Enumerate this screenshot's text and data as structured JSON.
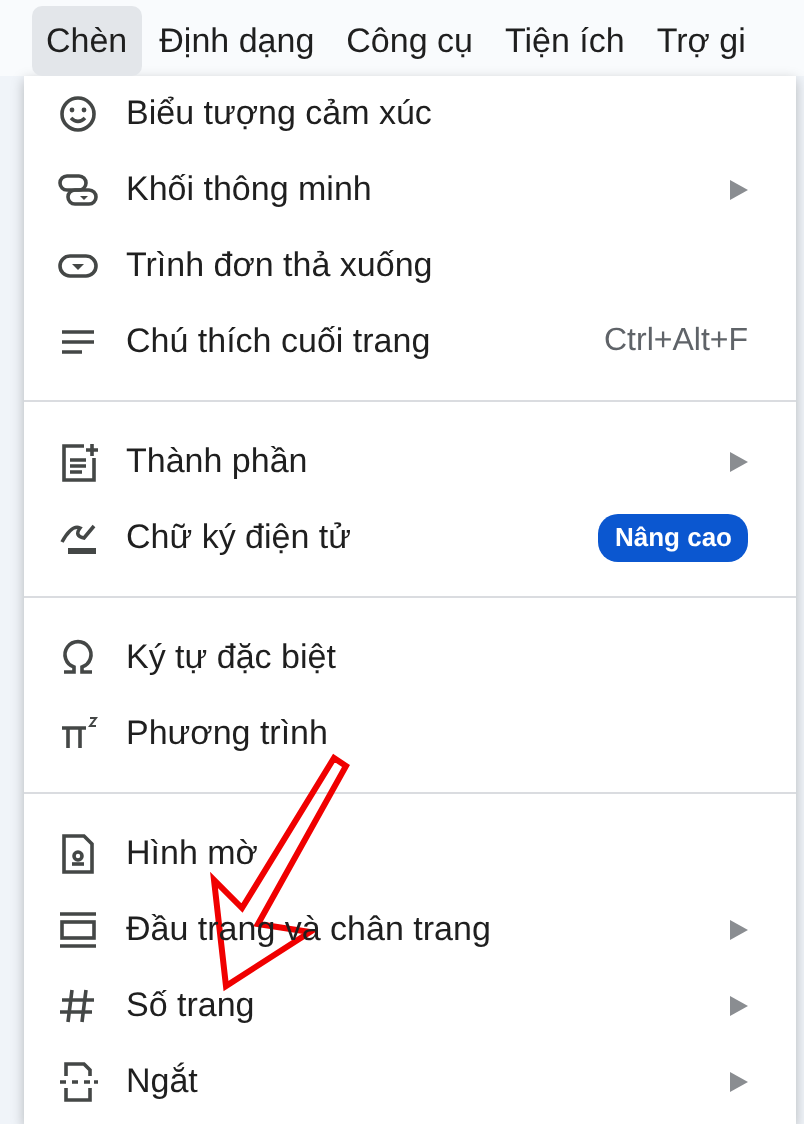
{
  "menubar": [
    {
      "label": "Chèn",
      "selected": true
    },
    {
      "label": "Định dạng",
      "selected": false
    },
    {
      "label": "Công cụ",
      "selected": false
    },
    {
      "label": "Tiện ích",
      "selected": false
    },
    {
      "label": "Trợ gi",
      "selected": false
    }
  ],
  "menu": {
    "items": [
      {
        "kind": "item",
        "label": "Biểu tượng cảm xúc",
        "submenu": false
      },
      {
        "kind": "item",
        "label": "Khối thông minh",
        "submenu": true
      },
      {
        "kind": "item",
        "label": "Trình đơn thả xuống",
        "submenu": false
      },
      {
        "kind": "item",
        "label": "Chú thích cuối trang",
        "submenu": false,
        "shortcut": "Ctrl+Alt+F"
      },
      {
        "kind": "divider"
      },
      {
        "kind": "item",
        "label": "Thành phần",
        "submenu": true
      },
      {
        "kind": "item",
        "label": "Chữ ký điện tử",
        "submenu": false,
        "badge": "Nâng cao"
      },
      {
        "kind": "divider"
      },
      {
        "kind": "item",
        "label": "Ký tự đặc biệt",
        "submenu": false
      },
      {
        "kind": "item",
        "label": "Phương trình",
        "submenu": false
      },
      {
        "kind": "divider"
      },
      {
        "kind": "item",
        "label": "Hình mờ",
        "submenu": false
      },
      {
        "kind": "item",
        "label": "Đầu trang và chân trang",
        "submenu": true
      },
      {
        "kind": "item",
        "label": "Số trang",
        "submenu": true
      },
      {
        "kind": "item",
        "label": "Ngắt",
        "submenu": true
      }
    ]
  }
}
